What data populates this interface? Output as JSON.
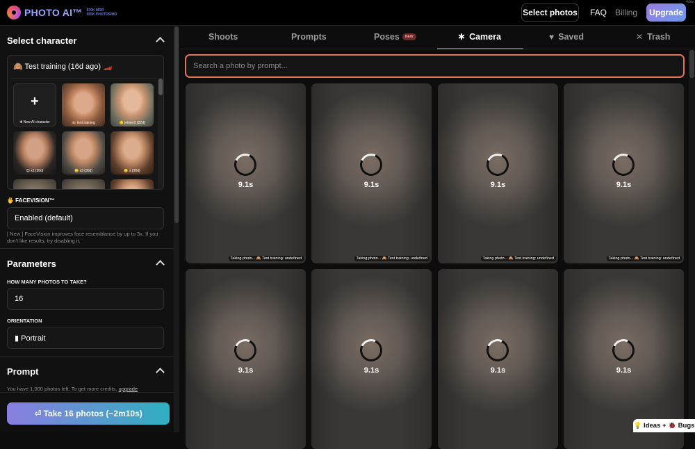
{
  "header": {
    "logo_text": "PHOTO AI™",
    "logo_stats_1": "$70K MRR",
    "logo_stats_2": "955K PHOTOS/MO",
    "select_photos": "Select photos",
    "faq": "FAQ",
    "billing": "Billing",
    "upgrade": "Upgrade",
    "corner": "4dev"
  },
  "sidebar": {
    "select_character_title": "Select character",
    "current_character": "🙈 Test training (16d ago) 🏎️",
    "tiles": [
      {
        "label": "✚ New AI character",
        "icon": "plus-icon"
      },
      {
        "label": "🙈 test training"
      },
      {
        "label": "🙂 jelmer2 (22d)"
      },
      {
        "label": "😊 x2 (30d)"
      },
      {
        "label": "🙂 x3 (30d)"
      },
      {
        "label": "🙂 x (30d)"
      },
      {
        "label": ""
      },
      {
        "label": ""
      },
      {
        "label": ""
      }
    ],
    "facevision_label": "🖐 FACEVISION™",
    "facevision_value": "Enabled (default)",
    "facevision_help": "[ New ] FaceVision improves face resemblance by up to 3x. If you don't like results, try disabling it.",
    "parameters_title": "Parameters",
    "how_many_label": "HOW MANY PHOTOS TO TAKE?",
    "how_many_value": "16",
    "orientation_label": "ORIENTATION",
    "orientation_value": "▮ Portrait",
    "prompt_title": "Prompt",
    "credits_text": "You have 1,000 photos left. To get more credits, ",
    "credits_link": "upgrade",
    "take_button": "⏎ Take 16 photos (~2m10s)"
  },
  "tabs": [
    {
      "label": "Shoots",
      "icon": ""
    },
    {
      "label": "Prompts",
      "icon": ""
    },
    {
      "label": "Poses",
      "icon": "",
      "badge": "NEW"
    },
    {
      "label": "Camera",
      "icon": "✱"
    },
    {
      "label": "Saved",
      "icon": "♥"
    },
    {
      "label": "Trash",
      "icon": "✕"
    }
  ],
  "search": {
    "placeholder": "Search a photo by prompt..."
  },
  "photos": [
    {
      "timer": "9.1s",
      "caption": "Taking photo... 🙈 Test training: undefined"
    },
    {
      "timer": "9.1s",
      "caption": "Taking photo... 🙈 Test training: undefined"
    },
    {
      "timer": "9.1s",
      "caption": "Taking photo... 🙈 Test training: undefined"
    },
    {
      "timer": "9.1s",
      "caption": "Taking photo... 🙈 Test training: undefined"
    },
    {
      "timer": "9.1s",
      "caption": ""
    },
    {
      "timer": "9.1s",
      "caption": ""
    },
    {
      "timer": "9.1s",
      "caption": ""
    },
    {
      "timer": "9.1s",
      "caption": ""
    }
  ],
  "feedback": {
    "label": "💡 Ideas + 🐞 Bugs"
  },
  "colors": {
    "search_border": "#e2745a",
    "upgrade_gradient_start": "#9a7be0",
    "take_button_gradient_end": "#2fb0c0"
  }
}
